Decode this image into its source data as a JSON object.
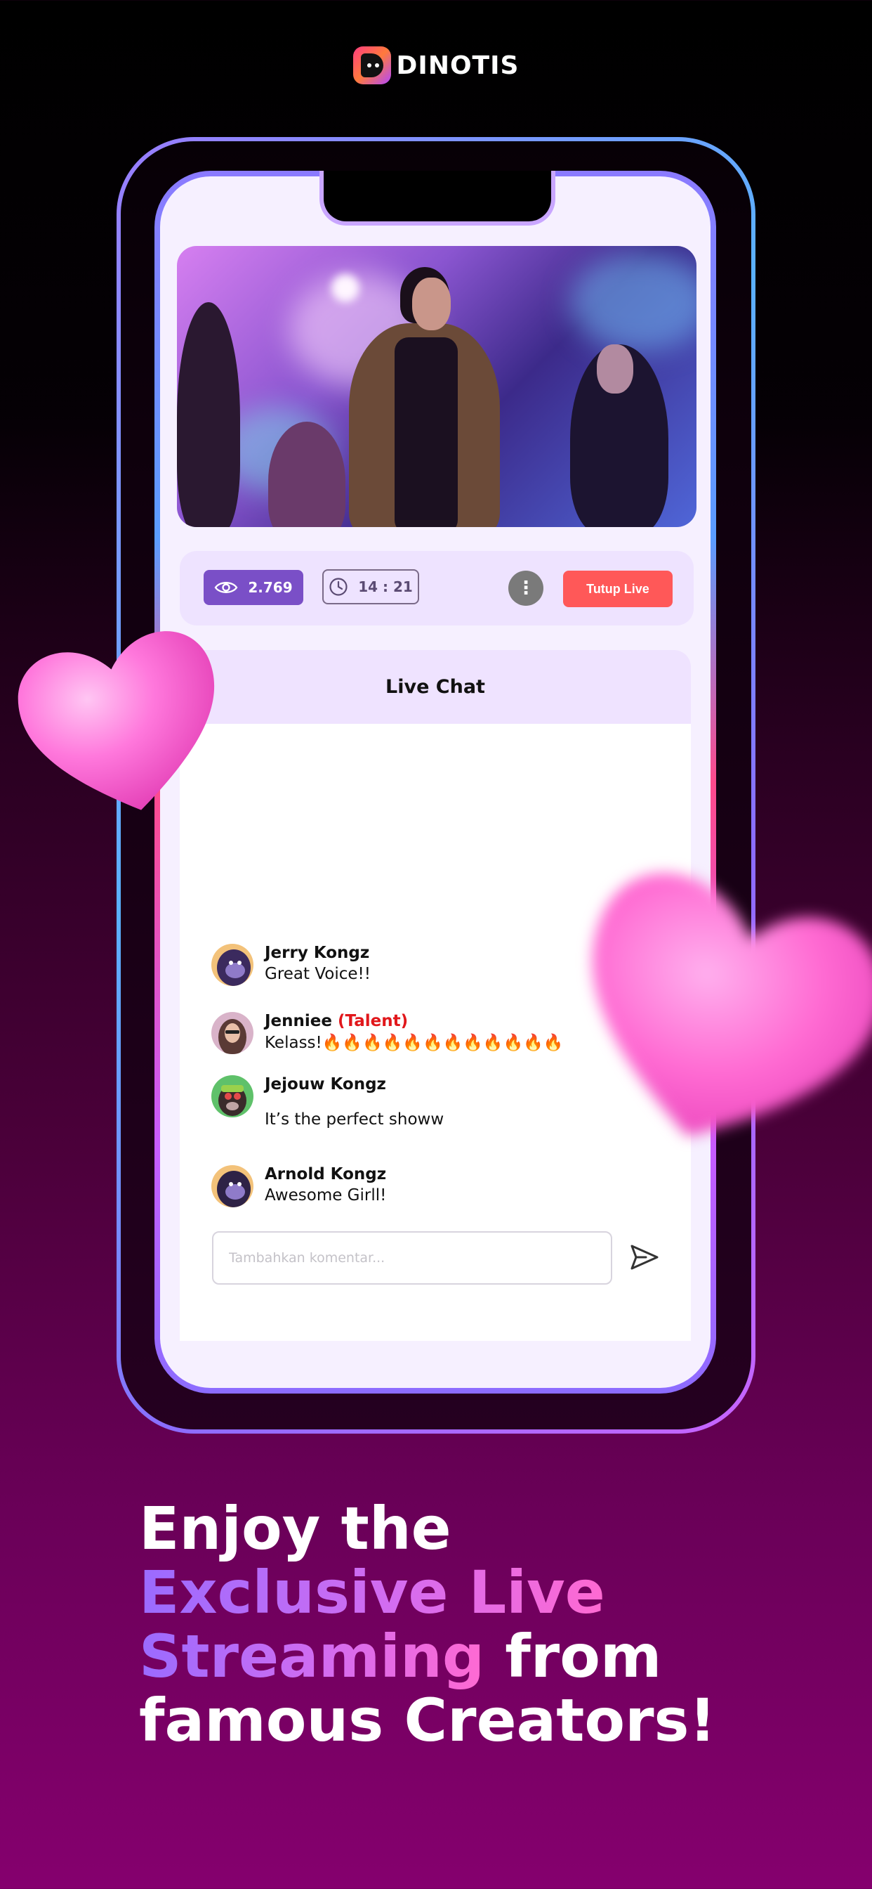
{
  "brand": {
    "name": "DINOTIS"
  },
  "stream": {
    "viewers": "2.769",
    "duration": "14 : 21",
    "end_label": "Tutup Live"
  },
  "chat": {
    "title": "Live Chat",
    "messages": [
      {
        "name": "Jerry Kongz",
        "tag": "",
        "text": "Great Voice!!",
        "avatar": "gorilla-avatar"
      },
      {
        "name": "Jenniee",
        "tag": "(Talent)",
        "text": "Kelass!🔥🔥🔥🔥🔥🔥🔥🔥🔥🔥🔥🔥",
        "avatar": "woman-avatar"
      },
      {
        "name": "Jejouw Kongz",
        "tag": "",
        "text": "It’s the perfect showw",
        "avatar": "ape-headphones-avatar"
      },
      {
        "name": "Arnold Kongz",
        "tag": "",
        "text": "Awesome Girll!",
        "avatar": "gorilla-avatar"
      }
    ],
    "input_placeholder": "Tambahkan komentar..."
  },
  "headline": {
    "line1": "Enjoy the",
    "line2": "Exclusive Live",
    "line3_highlight": "Streaming",
    "line3_rest": " from",
    "line4": "famous Creators!"
  },
  "colors": {
    "accent_purple": "#7a4fc7",
    "end_live_red": "#ff5858",
    "talent_red": "#e1171b",
    "heart_pink": "#ff6ad2"
  }
}
